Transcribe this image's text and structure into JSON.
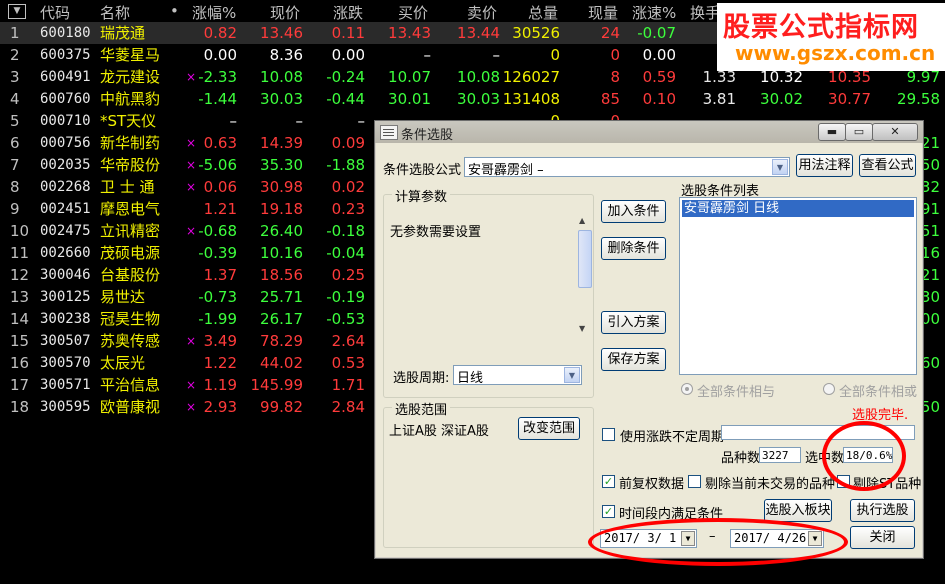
{
  "header": {
    "sort_icon": "triangle-down-icon",
    "cols": [
      "代码",
      "名称",
      "•",
      "涨幅%",
      "现价",
      "涨跌",
      "买价",
      "卖价",
      "总量",
      "现量",
      "涨速%",
      "换手"
    ]
  },
  "rows": [
    {
      "idx": "1",
      "code": "600180",
      "name": "瑞茂通",
      "mark": "",
      "chg": "0.82",
      "price": "13.46",
      "diff": "0.11",
      "bid": "13.43",
      "ask": "13.44",
      "vol": "30526",
      "cur": "24",
      "spd": "-0.07",
      "turn": "0",
      "x1": "",
      "x2": "",
      "x3": "",
      "dir": "up"
    },
    {
      "idx": "2",
      "code": "600375",
      "name": "华菱星马",
      "mark": "",
      "chg": "0.00",
      "price": "8.36",
      "diff": "0.00",
      "bid": "–",
      "ask": "–",
      "vol": "0",
      "cur": "0",
      "spd": "0.00",
      "turn": "0",
      "x1": "",
      "x2": "",
      "x3": "",
      "dir": "fl"
    },
    {
      "idx": "3",
      "code": "600491",
      "name": "龙元建设",
      "mark": "×",
      "chg": "-2.33",
      "price": "10.08",
      "diff": "-0.24",
      "bid": "10.07",
      "ask": "10.08",
      "vol": "126027",
      "cur": "8",
      "spd": "0.59",
      "turn": "1.33",
      "x1": "10.32",
      "x2": "10.35",
      "x3": "9.97",
      "dir": "dn"
    },
    {
      "idx": "4",
      "code": "600760",
      "name": "中航黑豹",
      "mark": "",
      "chg": "-1.44",
      "price": "30.03",
      "diff": "-0.44",
      "bid": "30.01",
      "ask": "30.03",
      "vol": "131408",
      "cur": "85",
      "spd": "0.10",
      "turn": "3.81",
      "x1": "30.02",
      "x2": "30.77",
      "x3": "29.58",
      "dir": "dn"
    },
    {
      "idx": "5",
      "code": "000710",
      "name": "*ST天仪",
      "mark": "",
      "chg": "–",
      "price": "–",
      "diff": "–",
      "bid": "–",
      "ask": "–",
      "vol": "0",
      "cur": "0",
      "spd": "–",
      "turn": "",
      "x1": "",
      "x2": "",
      "x3": "",
      "dir": "fl"
    },
    {
      "idx": "6",
      "code": "000756",
      "name": "新华制药",
      "mark": "×",
      "chg": "0.63",
      "price": "14.39",
      "diff": "0.09",
      "bid": "",
      "ask": "",
      "vol": "",
      "cur": "",
      "spd": "",
      "turn": "",
      "x1": "",
      "x2": "",
      "x3": "21",
      "dir": "up"
    },
    {
      "idx": "7",
      "code": "002035",
      "name": "华帝股份",
      "mark": "×",
      "chg": "-5.06",
      "price": "35.30",
      "diff": "-1.88",
      "bid": "",
      "ask": "",
      "vol": "",
      "cur": "",
      "spd": "",
      "turn": "",
      "x1": "",
      "x2": "",
      "x3": "50",
      "dir": "dn"
    },
    {
      "idx": "8",
      "code": "002268",
      "name": "卫 士 通",
      "mark": "×",
      "chg": "0.06",
      "price": "30.98",
      "diff": "0.02",
      "bid": "",
      "ask": "",
      "vol": "",
      "cur": "",
      "spd": "",
      "turn": "",
      "x1": "",
      "x2": "",
      "x3": "32",
      "dir": "up"
    },
    {
      "idx": "9",
      "code": "002451",
      "name": "摩恩电气",
      "mark": "",
      "chg": "1.21",
      "price": "19.18",
      "diff": "0.23",
      "bid": "",
      "ask": "",
      "vol": "",
      "cur": "",
      "spd": "",
      "turn": "",
      "x1": "",
      "x2": "",
      "x3": "91",
      "dir": "up"
    },
    {
      "idx": "10",
      "code": "002475",
      "name": "立讯精密",
      "mark": "×",
      "chg": "-0.68",
      "price": "26.40",
      "diff": "-0.18",
      "bid": "",
      "ask": "",
      "vol": "",
      "cur": "",
      "spd": "",
      "turn": "",
      "x1": "",
      "x2": "",
      "x3": "51",
      "dir": "dn"
    },
    {
      "idx": "11",
      "code": "002660",
      "name": "茂硕电源",
      "mark": "",
      "chg": "-0.39",
      "price": "10.16",
      "diff": "-0.04",
      "bid": "",
      "ask": "",
      "vol": "",
      "cur": "",
      "spd": "",
      "turn": "",
      "x1": "",
      "x2": "",
      "x3": "16",
      "dir": "dn"
    },
    {
      "idx": "12",
      "code": "300046",
      "name": "台基股份",
      "mark": "",
      "chg": "1.37",
      "price": "18.56",
      "diff": "0.25",
      "bid": "",
      "ask": "",
      "vol": "",
      "cur": "",
      "spd": "",
      "turn": "",
      "x1": "",
      "x2": "",
      "x3": "21",
      "dir": "up"
    },
    {
      "idx": "13",
      "code": "300125",
      "name": "易世达",
      "mark": "",
      "chg": "-0.73",
      "price": "25.71",
      "diff": "-0.19",
      "bid": "",
      "ask": "",
      "vol": "",
      "cur": "",
      "spd": "",
      "turn": "",
      "x1": "",
      "x2": "",
      "x3": "30",
      "dir": "dn"
    },
    {
      "idx": "14",
      "code": "300238",
      "name": "冠昊生物",
      "mark": "",
      "chg": "-1.99",
      "price": "26.17",
      "diff": "-0.53",
      "bid": "",
      "ask": "",
      "vol": "",
      "cur": "",
      "spd": "",
      "turn": "",
      "x1": "",
      "x2": "",
      "x3": "00",
      "dir": "dn"
    },
    {
      "idx": "15",
      "code": "300507",
      "name": "苏奥传感",
      "mark": "×",
      "chg": "3.49",
      "price": "78.29",
      "diff": "2.64",
      "bid": "",
      "ask": "",
      "vol": "",
      "cur": "",
      "spd": "",
      "turn": "",
      "x1": "",
      "x2": "",
      "x3": "",
      "dir": "up"
    },
    {
      "idx": "16",
      "code": "300570",
      "name": "太辰光",
      "mark": "",
      "chg": "1.22",
      "price": "44.02",
      "diff": "0.53",
      "bid": "",
      "ask": "",
      "vol": "",
      "cur": "",
      "spd": "",
      "turn": "",
      "x1": "",
      "x2": "",
      "x3": "60",
      "dir": "up"
    },
    {
      "idx": "17",
      "code": "300571",
      "name": "平治信息",
      "mark": "×",
      "chg": "1.19",
      "price": "145.99",
      "diff": "1.71",
      "bid": "",
      "ask": "",
      "vol": "",
      "cur": "",
      "spd": "",
      "turn": "",
      "x1": "",
      "x2": "",
      "x3": "",
      "dir": "up"
    },
    {
      "idx": "18",
      "code": "300595",
      "name": "欧普康视",
      "mark": "×",
      "chg": "2.93",
      "price": "99.82",
      "diff": "2.84",
      "bid": "",
      "ask": "",
      "vol": "",
      "cur": "",
      "spd": "",
      "turn": "",
      "x1": "",
      "x2": "",
      "x3": "50",
      "dir": "up"
    }
  ],
  "watermark": {
    "line1": "股票公式指标网",
    "line2": "www.gszx.com.cn"
  },
  "dialog": {
    "title": "条件选股",
    "title_buttons": {
      "min": "▬",
      "max": "▭",
      "close": "✕"
    },
    "formula_label": "条件选股公式",
    "formula_value": "安哥霹雳剑   –",
    "usage_btn": "用法注释",
    "view_btn": "查看公式",
    "calc_group": "计算参数",
    "no_params": "无参数需要设置",
    "period_label": "选股周期:",
    "period_value": "日线",
    "add_btn": "加入条件",
    "del_btn": "删除条件",
    "import_btn": "引入方案",
    "save_btn": "保存方案",
    "list_label": "选股条件列表",
    "list_items": [
      "安哥霹雳剑  日线"
    ],
    "radio_and": "全部条件相与",
    "radio_or": "全部条件相或",
    "status": "选股完毕.",
    "range_group": "选股范围",
    "range_value": "上证A股 深证A股",
    "change_range_btn": "改变范围",
    "uncertain_label": "使用涨跌不定周期",
    "count_label": "品种数",
    "count_value": "3227",
    "selected_label": "选中数",
    "selected_value": "18/0.6%",
    "pre_adjust": "前复权数据",
    "exclude_untraded": "剔除当前未交易的品种",
    "exclude_st": "剔除ST品种",
    "period_condition": "时间段内满足条件",
    "to_board_btn": "选股入板块",
    "run_btn": "执行选股",
    "date_from": "2017/ 3/ 1",
    "date_sep": "–",
    "date_to": "2017/ 4/26",
    "close_btn": "关闭",
    "highlight_color": "#ff0000"
  }
}
